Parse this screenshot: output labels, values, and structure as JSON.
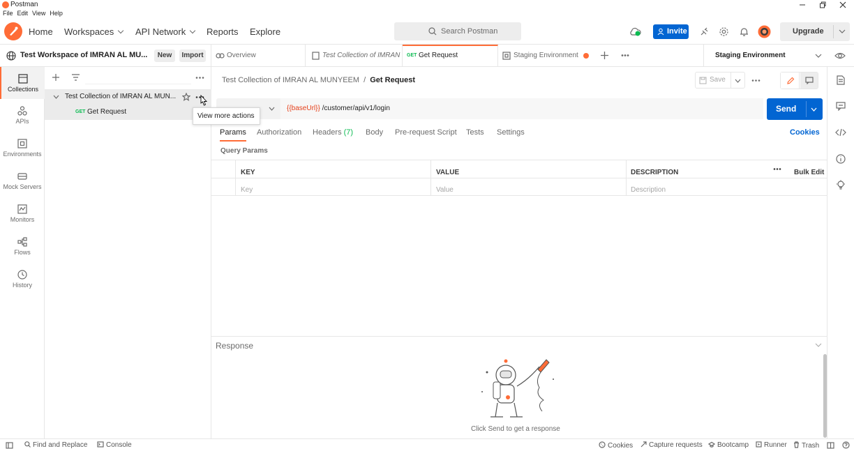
{
  "window": {
    "title": "Postman"
  },
  "menu": [
    "File",
    "Edit",
    "View",
    "Help"
  ],
  "header": {
    "home": "Home",
    "workspaces": "Workspaces",
    "api_network": "API Network",
    "reports": "Reports",
    "explore": "Explore",
    "search_placeholder": "Search Postman",
    "invite": "Invite",
    "upgrade": "Upgrade"
  },
  "workspace": {
    "name": "Test Workspace of IMRAN AL MU...",
    "new_label": "New",
    "import_label": "Import"
  },
  "tabs": {
    "overview": "Overview",
    "collection": "Test Collection of IMRAN",
    "request_method": "GET",
    "request": "Get Request",
    "environment": "Staging Environment",
    "env_selector": "Staging Environment"
  },
  "leftnav": [
    {
      "label": "Collections",
      "icon": "collections-icon"
    },
    {
      "label": "APIs",
      "icon": "apis-icon"
    },
    {
      "label": "Environments",
      "icon": "environments-icon"
    },
    {
      "label": "Mock Servers",
      "icon": "mock-servers-icon"
    },
    {
      "label": "Monitors",
      "icon": "monitors-icon"
    },
    {
      "label": "Flows",
      "icon": "flows-icon"
    },
    {
      "label": "History",
      "icon": "history-icon"
    }
  ],
  "sidebar": {
    "collection_name": "Test Collection of IMRAN AL MUN...",
    "request_method": "GET",
    "request_name": "Get Request",
    "tooltip": "View more actions"
  },
  "request": {
    "breadcrumb_collection": "Test Collection of IMRAN AL MUNYEEM",
    "breadcrumb_sep": "/",
    "breadcrumb_request": "Get Request",
    "save_label": "Save",
    "url_var": "{{baseUrl}}",
    "url_path": " /customer/api/v1/login",
    "send_label": "Send",
    "cookies_label": "Cookies",
    "tabs": {
      "params": "Params",
      "authorization": "Authorization",
      "headers": "Headers",
      "headers_count": "(7)",
      "body": "Body",
      "prerequest": "Pre-request Script",
      "tests": "Tests",
      "settings": "Settings"
    },
    "query_params_title": "Query Params",
    "columns": {
      "key": "KEY",
      "value": "VALUE",
      "description": "DESCRIPTION",
      "bulk_edit": "Bulk Edit"
    },
    "placeholders": {
      "key": "Key",
      "value": "Value",
      "description": "Description"
    }
  },
  "response": {
    "title": "Response",
    "empty_message": "Click Send to get a response"
  },
  "statusbar": {
    "find_replace": "Find and Replace",
    "console": "Console",
    "cookies": "Cookies",
    "capture": "Capture requests",
    "bootcamp": "Bootcamp",
    "runner": "Runner",
    "trash": "Trash"
  },
  "colors": {
    "accent": "#ff6c37",
    "primary": "#0265d2",
    "get_method": "#0cbb52",
    "variable": "#e5411b"
  }
}
